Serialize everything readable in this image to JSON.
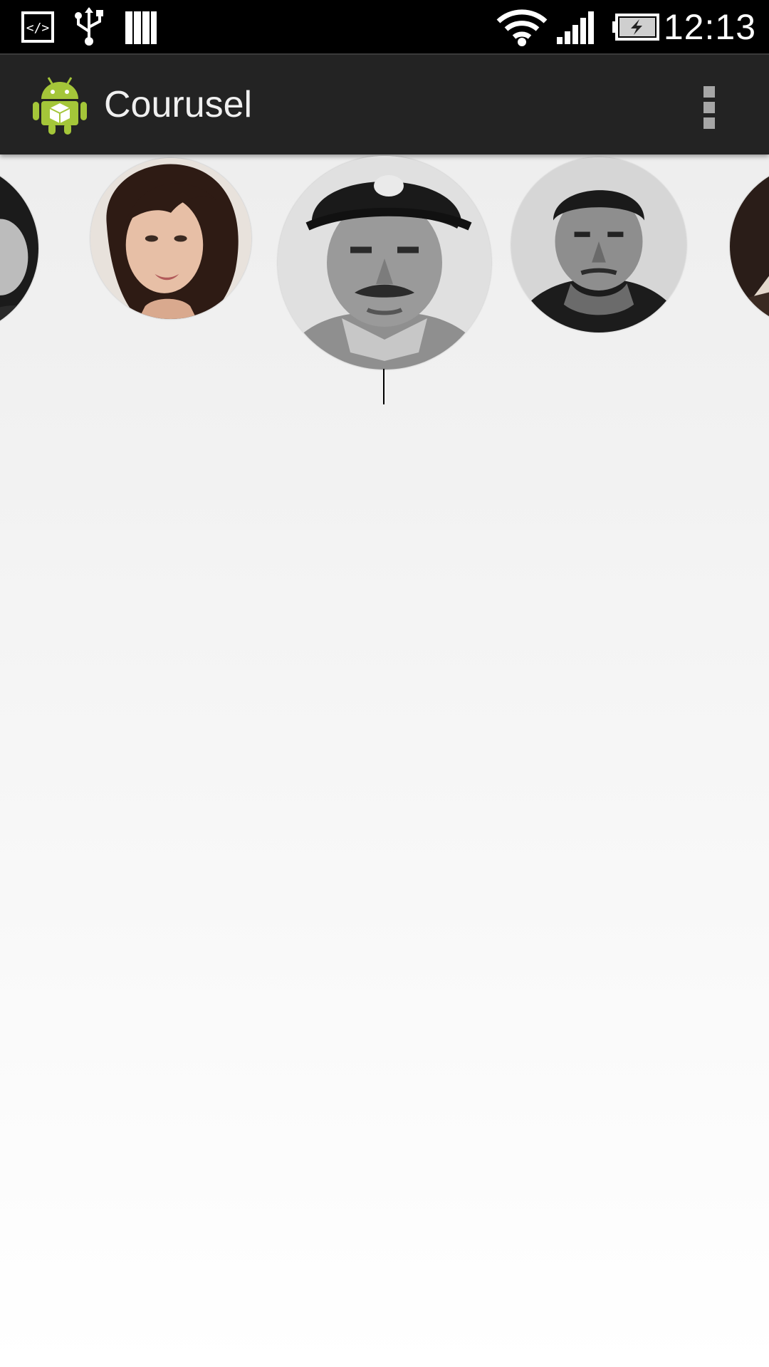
{
  "status_bar": {
    "time": "12:13",
    "icons": [
      "developer-code-icon",
      "usb-icon",
      "cards-icon",
      "wifi-icon",
      "signal-icon",
      "battery-charging-icon"
    ]
  },
  "action_bar": {
    "title": "Courusel",
    "app_icon": "android-app-icon",
    "overflow_icon": "overflow-menu-icon"
  },
  "carousel": {
    "selected_index": 2,
    "items": [
      {
        "name": "portrait-1",
        "partially_visible": true
      },
      {
        "name": "portrait-2"
      },
      {
        "name": "portrait-3",
        "selected": true
      },
      {
        "name": "portrait-4"
      },
      {
        "name": "portrait-5",
        "partially_visible": true
      }
    ]
  },
  "colors": {
    "status_bar_bg": "#000000",
    "action_bar_bg": "#232323",
    "content_bg_top": "#ececec",
    "content_bg_bottom": "#ffffff",
    "android_green": "#a4c639"
  }
}
